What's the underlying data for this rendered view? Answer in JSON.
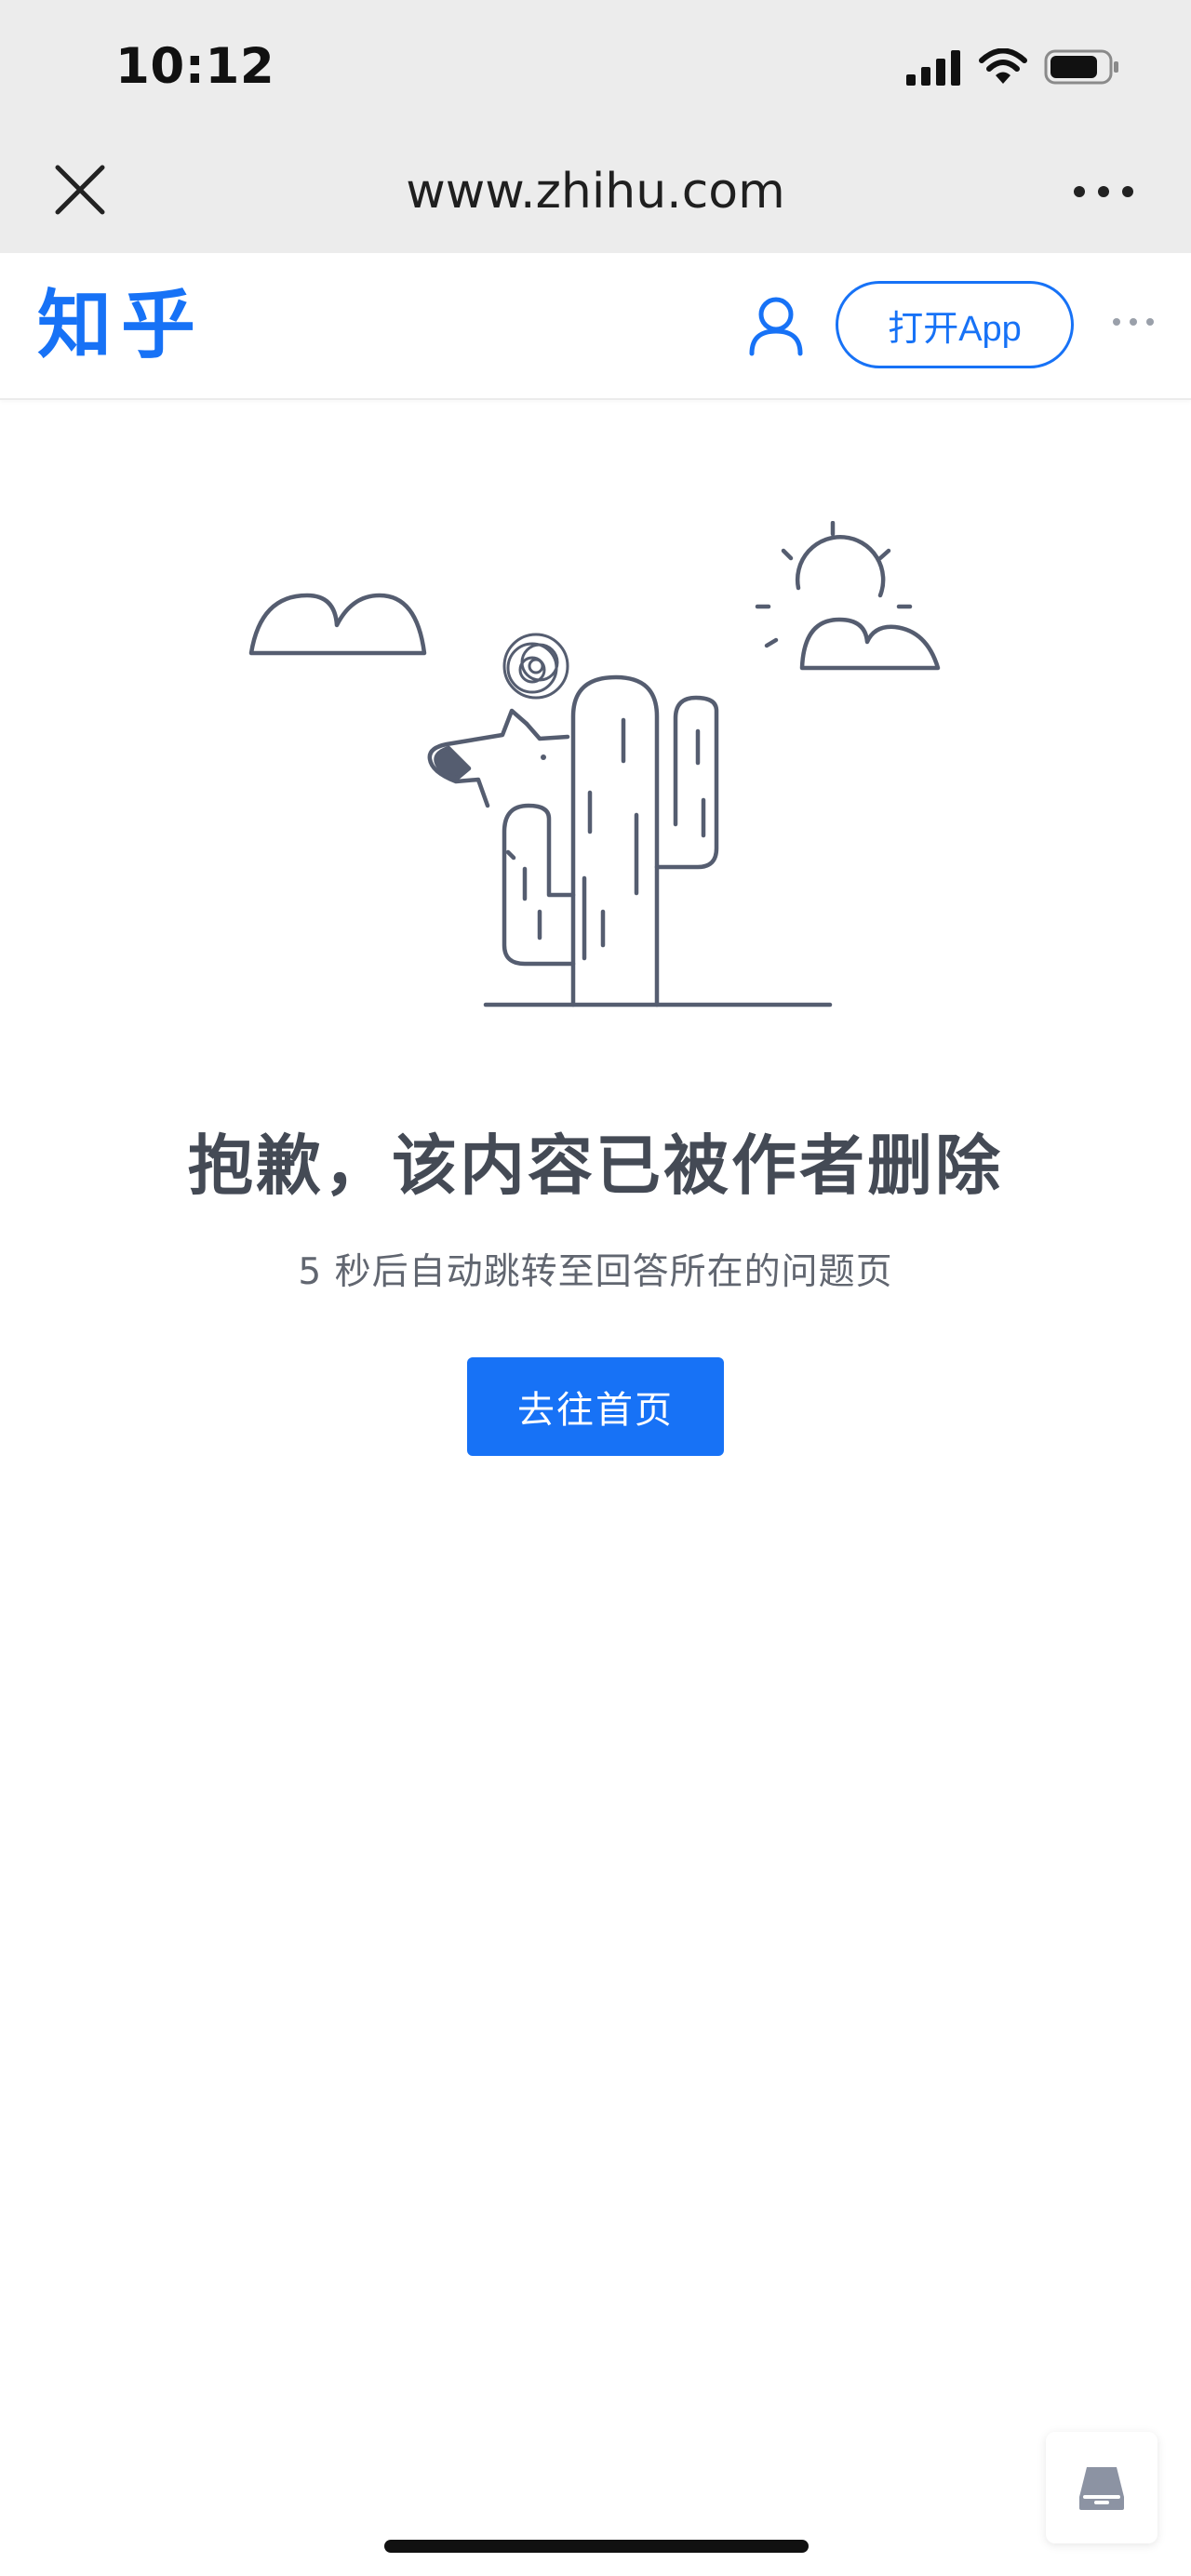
{
  "status_bar": {
    "time": "10:12",
    "icons": [
      "cellular-signal-icon",
      "wifi-icon",
      "battery-icon"
    ]
  },
  "browser": {
    "url": "www.zhihu.com",
    "close_icon": "close-icon",
    "more_icon": "more-horizontal-icon"
  },
  "header": {
    "logo": "知乎",
    "user_icon": "user-icon",
    "open_app_label": "打开App",
    "more_icon": "more-horizontal-icon"
  },
  "main": {
    "illustration": "cactus-and-dog-illustration",
    "headline": "抱歉，该内容已被作者删除",
    "subline": "5 秒后自动跳转至回答所在的问题页",
    "home_button_label": "去往首页"
  },
  "bottom": {
    "tool_icon": "tray-icon"
  },
  "colors": {
    "brand": "#1772f6",
    "chrome_bg": "#ececec",
    "illustration_stroke": "#555d70",
    "headline_text": "#444a55"
  }
}
